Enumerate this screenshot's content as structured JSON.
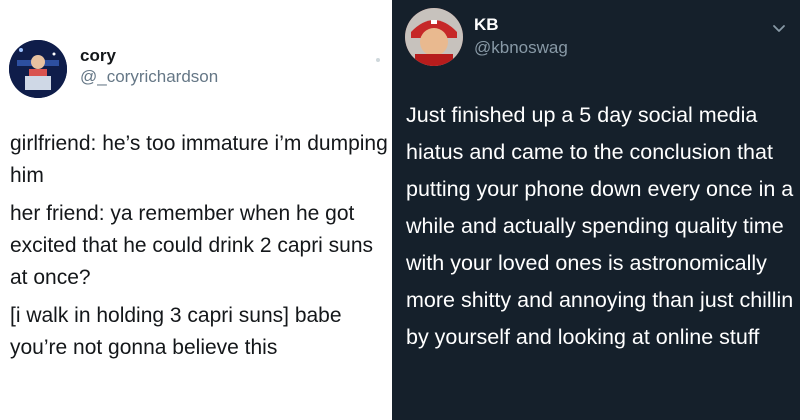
{
  "left_tweet": {
    "author_name": "cory",
    "author_handle": "@_coryrichardson",
    "avatar_icon": "profile-photo",
    "paragraphs": [
      "girlfriend: he’s too immature i’m dumping him",
      "her friend: ya remember when he got excited that he could drink 2 capri suns at once?",
      "[i walk in holding 3 capri suns] babe you’re not gonna believe this"
    ]
  },
  "right_tweet": {
    "author_name": "KB",
    "author_handle": "@kbnoswag",
    "avatar_icon": "profile-photo",
    "text": "Just finished up a 5 day social media hiatus and came to the conclusion that putting your phone down every once in a while and actually spending quality time with your loved ones is astronomically more shitty and annoying than just chillin by yourself and looking at online stuff",
    "menu_icon": "chevron-down-icon"
  },
  "colors": {
    "left_background": "#ffffff",
    "right_background": "#15202b",
    "left_text": "#14171a",
    "left_handle": "#657786",
    "right_text": "#ffffff",
    "right_handle": "#8899a6"
  }
}
